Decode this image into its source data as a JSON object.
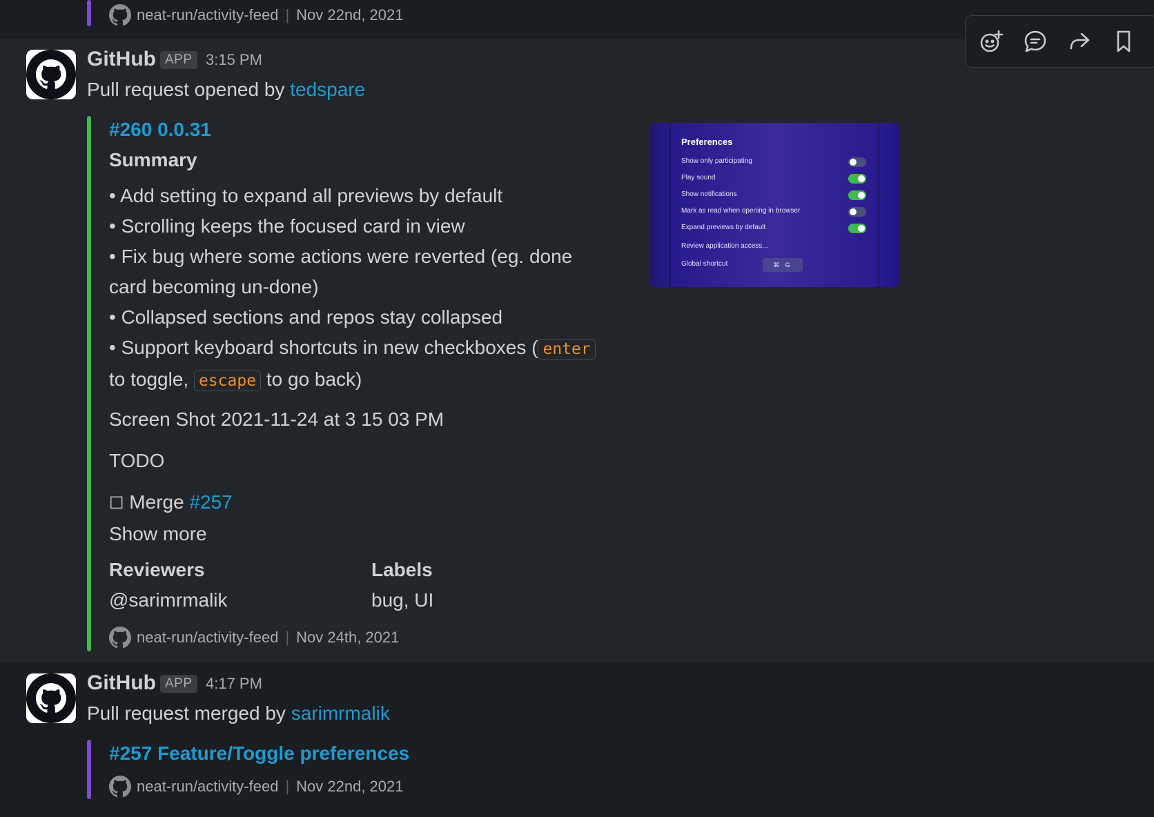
{
  "previous_message": {
    "repo": "neat-run/activity-feed",
    "date": "Nov 22nd, 2021"
  },
  "toolbar": {
    "icons": [
      "add-reaction-icon",
      "reply-in-thread-icon",
      "share-icon",
      "bookmark-icon"
    ]
  },
  "messages": [
    {
      "sender": "GitHub",
      "badge": "APP",
      "time": "3:15 PM",
      "action_text": "Pull request opened by",
      "user": "tedspare",
      "attachment": {
        "title": "#260 0.0.31",
        "heading": "Summary",
        "bullets": [
          "• Add setting to expand all previews by default",
          "• Scrolling keeps the focused card in view",
          "• Fix bug where some actions were reverted (eg. done",
          "card becoming un-done)",
          "• Collapsed sections and repos stay collapsed"
        ],
        "shortcut_line_start": "• Support keyboard shortcuts in new checkboxes (",
        "code_enter": "enter",
        "toggle_text": "to toggle,",
        "code_escape": "escape",
        "back_text": "to go back)",
        "screenshot_link": "Screen Shot 2021-11-24 at 3 15 03 PM",
        "todo": "TODO",
        "checkbox": "☐",
        "merge_text": "Merge",
        "merge_link": "#257",
        "show_more": "Show more",
        "fields": [
          {
            "label": "Reviewers",
            "value": "@sarimrmalik"
          },
          {
            "label": "Labels",
            "value": "bug, UI"
          }
        ],
        "repo": "neat-run/activity-feed",
        "date": "Nov 24th, 2021",
        "preview": {
          "title": "Preferences",
          "rows": [
            {
              "label": "Show only participating",
              "toggle": "off"
            },
            {
              "label": "Play sound",
              "toggle": "on"
            },
            {
              "label": "Show notifications",
              "toggle": "on"
            },
            {
              "label": "Mark as read when opening in browser",
              "toggle": "off"
            },
            {
              "label": "Expand previews by default",
              "toggle": "on"
            }
          ],
          "review_access": "Review application access...",
          "global_shortcut": "Global shortcut",
          "shortcut_keys": "⌘ G"
        }
      }
    },
    {
      "sender": "GitHub",
      "badge": "APP",
      "time": "4:17 PM",
      "action_text": "Pull request merged by",
      "user": "sarimrmalik",
      "attachment": {
        "title": "#257 Feature/Toggle preferences",
        "repo": "neat-run/activity-feed",
        "date": "Nov 22nd, 2021"
      }
    }
  ],
  "colors": {
    "background": "#1a1d21",
    "hover_background": "#222529",
    "link": "#1d9bd1",
    "bar_purple": "#7c4dd1",
    "bar_green": "#3fb950",
    "code": "#e8912d"
  }
}
